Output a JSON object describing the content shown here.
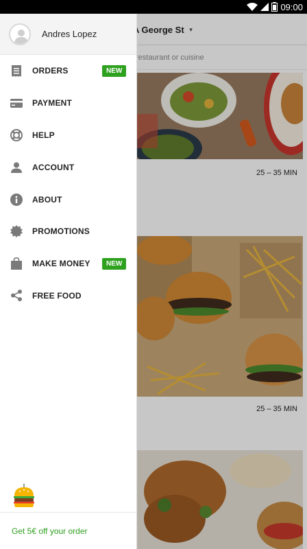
{
  "status_bar": {
    "time": "09:00"
  },
  "background_app": {
    "address": "A George St",
    "search_placeholder": "restaurant or cuisine",
    "restaurants": [
      {
        "eta": "25 – 35 MIN"
      },
      {
        "eta": "25 – 35 MIN"
      }
    ]
  },
  "drawer": {
    "user_name": "Andres Lopez",
    "menu": [
      {
        "label": "ORDERS",
        "icon": "receipt-icon",
        "badge": "NEW"
      },
      {
        "label": "PAYMENT",
        "icon": "credit-card-icon"
      },
      {
        "label": "HELP",
        "icon": "lifebuoy-icon"
      },
      {
        "label": "ACCOUNT",
        "icon": "person-icon"
      },
      {
        "label": "ABOUT",
        "icon": "info-icon"
      },
      {
        "label": "PROMOTIONS",
        "icon": "seal-badge-icon"
      },
      {
        "label": "MAKE MONEY",
        "icon": "shopping-bag-icon",
        "badge": "NEW"
      },
      {
        "label": "FREE FOOD",
        "icon": "share-icon"
      }
    ],
    "footer": {
      "promo_text": "Get 5€ off your order"
    }
  },
  "colors": {
    "accent_green": "#2ea11f",
    "icon_gray": "#7a7a7a"
  }
}
